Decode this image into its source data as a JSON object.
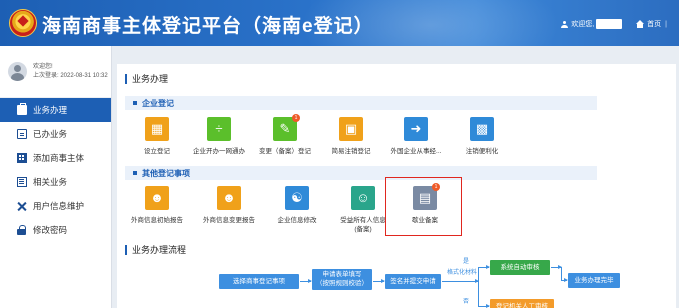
{
  "header": {
    "title": "海南商事主体登记平台（海南e登记）",
    "welcome": "欢迎您,",
    "home": "首页",
    "divider": "|"
  },
  "sidebar": {
    "profile": {
      "greeting": "欢迎您!",
      "last_login": "上次登录: 2022-08-31 10:32"
    },
    "items": [
      {
        "label": "业务办理",
        "icon": "briefcase-icon",
        "active": true
      },
      {
        "label": "已办业务",
        "icon": "document-icon",
        "active": false
      },
      {
        "label": "添加商事主体",
        "icon": "building-icon",
        "active": false
      },
      {
        "label": "相关业务",
        "icon": "list-icon",
        "active": false
      },
      {
        "label": "用户信息维护",
        "icon": "tools-icon",
        "active": false
      },
      {
        "label": "修改密码",
        "icon": "lock-icon",
        "active": false
      }
    ]
  },
  "main": {
    "section_title": "业务办理",
    "enterprise": {
      "title": "企业登记",
      "tiles": [
        {
          "label": "设立登记",
          "icon": "form-icon",
          "color": "#f0a11a"
        },
        {
          "label": "企业开办一网通办",
          "icon": "network-icon",
          "color": "#5bbf2b"
        },
        {
          "label": "变更（备案）登记",
          "icon": "edit-icon",
          "color": "#5bbf2b",
          "badge": "1"
        },
        {
          "label": "简易注销登记",
          "icon": "cancel-icon",
          "color": "#f0a11a"
        },
        {
          "label": "外国企业从事经...",
          "icon": "export-icon",
          "color": "#2f8ad8"
        },
        {
          "label": "注销便利化",
          "icon": "stamp-icon",
          "color": "#2f8ad8"
        }
      ]
    },
    "other": {
      "title": "其他登记事项",
      "tiles": [
        {
          "label": "外商信息初始报告",
          "icon": "foreign-user-icon",
          "color": "#f0a11a"
        },
        {
          "label": "外商信息变更报告",
          "icon": "foreign-user-edit-icon",
          "color": "#f0a11a"
        },
        {
          "label": "企业信息修改",
          "icon": "user-edit-icon",
          "color": "#2f8ad8"
        },
        {
          "label": "受益所有人信息",
          "label2": "(备案)",
          "icon": "beneficiary-icon",
          "color": "#2aa58b"
        },
        {
          "label": "歇业备案",
          "icon": "suspend-icon",
          "color": "#7a8aa3",
          "badge": "1"
        }
      ]
    },
    "process": {
      "title": "业务办理流程",
      "steps": {
        "select": "选择商事登记事项",
        "fill_line1": "申请表单填写",
        "fill_line2": "（按照规则校验）",
        "sign": "签名并提交申请",
        "check": "格式化材料",
        "auto": "系统自动审核",
        "manual": "登记机关人工审核",
        "done": "业务办理完毕",
        "yes": "是",
        "no": "否"
      }
    }
  }
}
